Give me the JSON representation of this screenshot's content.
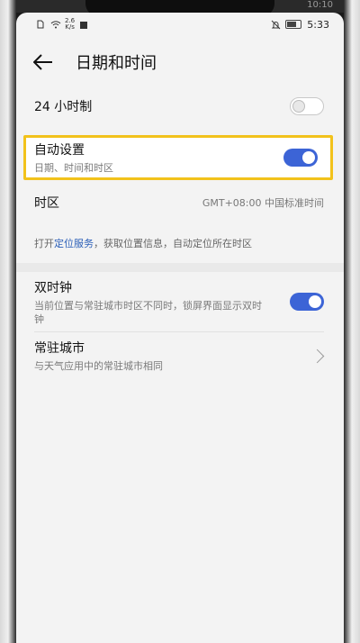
{
  "status_bar": {
    "net_speed": "2.6",
    "net_unit": "K/s",
    "time": "5:33",
    "outer_time": "10:10"
  },
  "header": {
    "title": "日期和时间"
  },
  "settings": {
    "hour24": {
      "label": "24 小时制",
      "enabled": false
    },
    "auto": {
      "label": "自动设置",
      "sub": "日期、时间和时区",
      "enabled": true
    },
    "timezone": {
      "label": "时区",
      "value": "GMT+08:00 中国标准时间"
    },
    "hint": {
      "prefix": "打开",
      "link": "定位服务",
      "suffix": "，获取位置信息，自动定位所在时区"
    },
    "dual_clock": {
      "label": "双时钟",
      "sub": "当前位置与常驻城市时区不同时，锁屏界面显示双时钟",
      "enabled": true
    },
    "home_city": {
      "label": "常驻城市",
      "sub": "与天气应用中的常驻城市相同"
    }
  },
  "icons": {
    "back": "arrow-left-icon",
    "chevron": "chevron-right-icon"
  },
  "colors": {
    "accent": "#3c64d6",
    "highlight": "#f2c21b",
    "link": "#2b5fb8"
  }
}
